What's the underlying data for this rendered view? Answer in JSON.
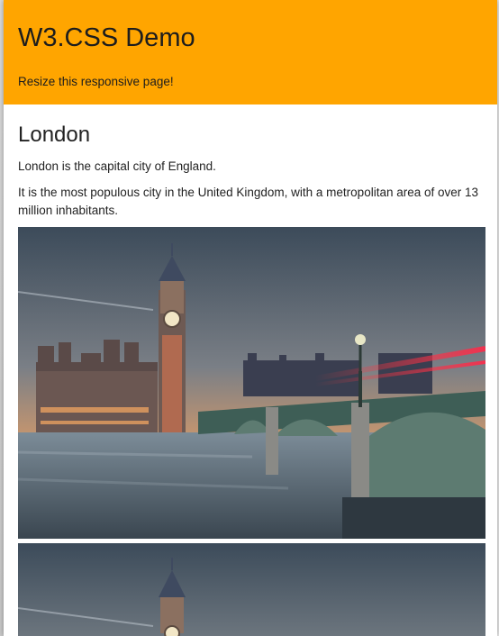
{
  "header": {
    "title": "W3.CSS Demo",
    "subtitle": "Resize this responsive page!",
    "background_color": "#ffa500"
  },
  "main": {
    "heading": "London",
    "paragraphs": [
      "London is the capital city of England.",
      "It is the most populous city in the United Kingdom, with a metropolitan area of over 13 million inhabitants."
    ],
    "images": [
      {
        "subject": "Big Ben and Westminster Bridge at dusk"
      },
      {
        "subject": "Big Ben and Westminster Bridge at dusk"
      }
    ]
  }
}
